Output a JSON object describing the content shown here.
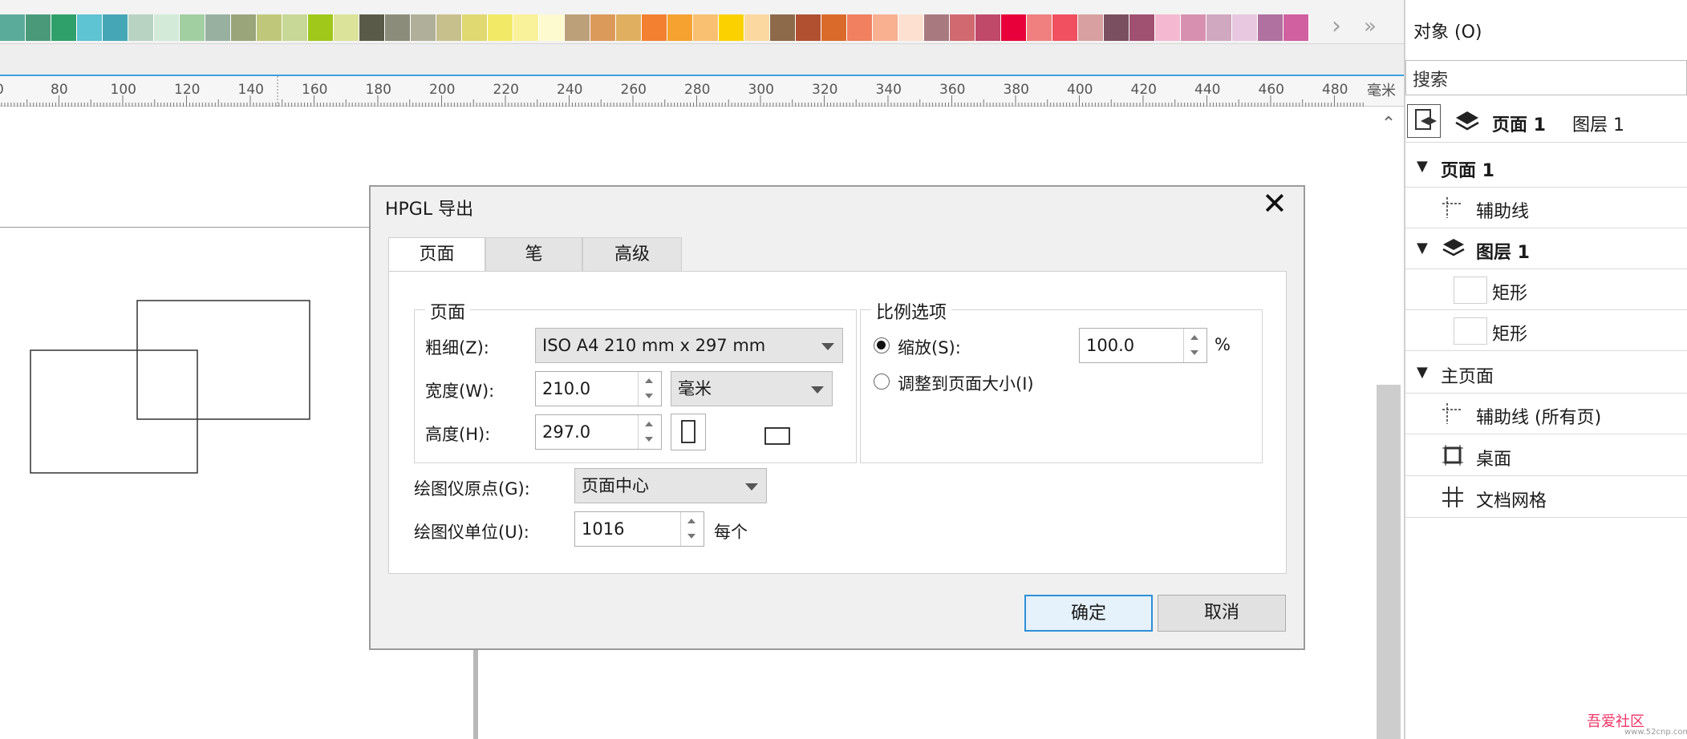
{
  "palette": {
    "colors": [
      "#5aab9a",
      "#4a9a7a",
      "#2fa06a",
      "#5ec3d2",
      "#45a7b6",
      "#b9d3c3",
      "#d4ead9",
      "#a1cfa1",
      "#98b0a0",
      "#9aa57a",
      "#bfc87a",
      "#c8d896",
      "#a0c81a",
      "#dbe39a",
      "#5a5a48",
      "#8c8c7a",
      "#b0b09a",
      "#c8c08c",
      "#e0d870",
      "#f2ea66",
      "#faf29a",
      "#fdfad0",
      "#bca07a",
      "#dc9a5a",
      "#e0b060",
      "#f38030",
      "#f6a230",
      "#f8c070",
      "#fbd200",
      "#fbd8a0",
      "#8c6a4a",
      "#b05030",
      "#da6a2a",
      "#f08060",
      "#f8b090",
      "#fde0d0",
      "#a87a80",
      "#d06a70",
      "#c04868",
      "#e8003a",
      "#f08080",
      "#f05060",
      "#d8a0a0",
      "#7a5060",
      "#a05070",
      "#f4b8d0",
      "#d890b0",
      "#d0a8c0",
      "#e8c8e0",
      "#b070a0",
      "#d060a0"
    ],
    "next_icon": "chevron-right-icon",
    "more_icon": "double-chevron-right-icon"
  },
  "ruler": {
    "labels": [
      "80",
      "100",
      "120",
      "140",
      "160",
      "180",
      "200",
      "220",
      "240",
      "260",
      "280",
      "300",
      "320",
      "340",
      "360",
      "380",
      "400",
      "420",
      "440",
      "460",
      "480"
    ],
    "first_partial": "0",
    "unit": "毫米"
  },
  "docker": {
    "title": "对象 (O)",
    "search_placeholder": "搜索",
    "current_page": "页面 1",
    "current_layer": "图层 1",
    "tree": [
      {
        "label": "页面 1",
        "bold": true,
        "icon": "triangle-down-icon"
      },
      {
        "label": "辅助线",
        "icon": "guideline-icon"
      },
      {
        "label": "图层 1",
        "bold": true,
        "icon": "layers-icon"
      },
      {
        "label": "矩形",
        "icon": "rectangle-swatch"
      },
      {
        "label": "矩形",
        "icon": "rectangle-swatch"
      },
      {
        "label": "主页面",
        "icon": "triangle-down-icon"
      },
      {
        "label": "辅助线 (所有页)",
        "icon": "guideline-icon"
      },
      {
        "label": "桌面",
        "icon": "desktop-icon"
      },
      {
        "label": "文档网格",
        "icon": "grid-icon"
      }
    ]
  },
  "dialog": {
    "title": "HPGL 导出",
    "tabs": [
      "页面",
      "笔",
      "高级"
    ],
    "page_group": {
      "title": "页面",
      "size_label": "粗细(Z):",
      "size_value": "ISO A4 210 mm x 297 mm",
      "width_label": "宽度(W):",
      "width_value": "210.0",
      "unit_value": "毫米",
      "height_label": "高度(H):",
      "height_value": "297.0"
    },
    "scale_group": {
      "title": "比例选项",
      "scale_label": "缩放(S):",
      "scale_value": "100.0",
      "scale_unit": "%",
      "fit_label": "调整到页面大小(I)",
      "selected": "scale"
    },
    "origin_label": "绘图仪原点(G):",
    "origin_value": "页面中心",
    "units_label": "绘图仪单位(U):",
    "units_value": "1016",
    "units_suffix": "每个",
    "ok_label": "确定",
    "cancel_label": "取消"
  },
  "watermark": {
    "text": "吾爱社区",
    "url": "www.52cnp.com"
  }
}
